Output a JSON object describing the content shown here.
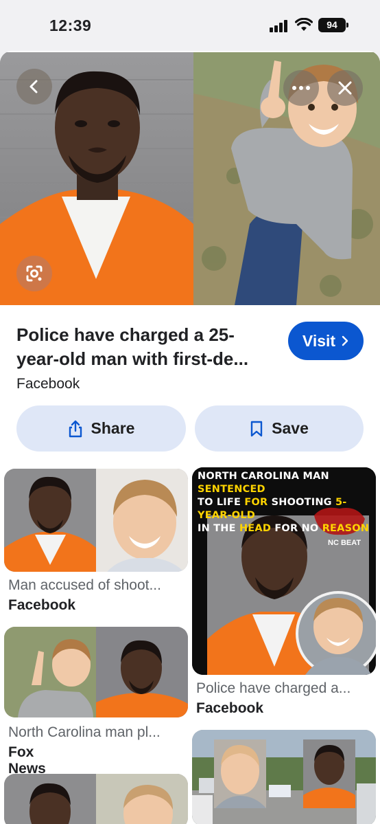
{
  "status_bar": {
    "time": "12:39",
    "battery": "94"
  },
  "result": {
    "title": "Police have charged a 25-year-old man with first-de...",
    "title_line1": "Police have charged a 25-",
    "title_line2": "year-old man with first-de...",
    "source": "Facebook",
    "visit_label": "Visit",
    "share_label": "Share",
    "save_label": "Save"
  },
  "cards": [
    {
      "title": "Man accused of shoot...",
      "source": "Facebook"
    },
    {
      "title": "Police have charged a...",
      "source": "Facebook",
      "banner": {
        "line1_w": "NORTH CAROLINA MAN ",
        "line1_y": "SENTENCED",
        "line2_w": "TO LIFE ",
        "line2_y": "FOR ",
        "line2_w2": "SHOOTING ",
        "line2_y2": "5-YEAR-OLD",
        "line3_w": "IN THE ",
        "line3_y": "HEAD ",
        "line3_w2": "FOR NO ",
        "line3_y2": "REASON"
      },
      "logo_text": "NC BEAT"
    },
    {
      "title": "North Carolina man pl...",
      "source": "Fox News"
    }
  ],
  "colors": {
    "accent": "#0b57d0",
    "button_bg": "#dfe7f7",
    "orange": "#f07a1c"
  },
  "icons": [
    "back-icon",
    "more-icon",
    "close-icon",
    "lens-icon",
    "share-icon",
    "bookmark-icon",
    "chevron-right-icon"
  ]
}
